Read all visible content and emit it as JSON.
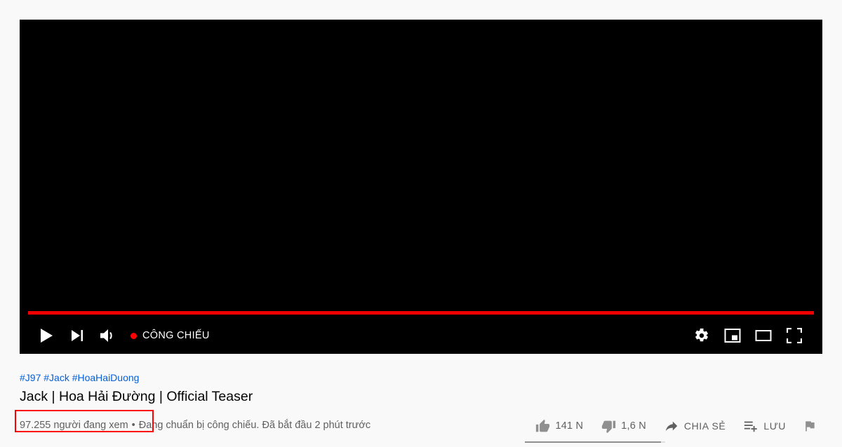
{
  "player": {
    "progress_percent": 100,
    "controls_left": [
      {
        "name": "play-button",
        "icon": "play-icon",
        "label": "Phát"
      },
      {
        "name": "next-button",
        "icon": "next-track-icon",
        "label": "Tiếp theo"
      },
      {
        "name": "volume-button",
        "icon": "volume-icon",
        "label": "Âm lượng"
      }
    ],
    "live_badge": {
      "label": "CÔNG CHIẾU",
      "dot_color": "#ff0000"
    },
    "controls_right": [
      {
        "name": "settings-button",
        "icon": "gear-icon",
        "label": "Cài đặt"
      },
      {
        "name": "miniplayer-button",
        "icon": "miniplayer-icon",
        "label": "Trình phát thu nhỏ"
      },
      {
        "name": "theater-button",
        "icon": "theater-mode-icon",
        "label": "Chế độ rạp hát"
      },
      {
        "name": "fullscreen-button",
        "icon": "fullscreen-icon",
        "label": "Toàn màn hình"
      }
    ]
  },
  "video": {
    "hashtags": [
      "#J97",
      "#Jack",
      "#HoaHaiDuong"
    ],
    "hashtags_text": "#J97 #Jack #HoaHaiDuong",
    "title": "Jack | Hoa Hải Đường | Official Teaser",
    "viewer_count_text": "97.255 người đang xem",
    "separator": "•",
    "status_text": "Đang chuẩn bị công chiếu. Đã bắt đầu 2 phút trước",
    "highlight_color": "#ff0000"
  },
  "actions": {
    "like": {
      "label": "141 N",
      "icon": "thumbs-up-icon"
    },
    "dislike": {
      "label": "1,6 N",
      "icon": "thumbs-down-icon"
    },
    "share": {
      "label": "CHIA SẺ",
      "icon": "share-icon"
    },
    "save": {
      "label": "LƯU",
      "icon": "save-to-playlist-icon"
    },
    "report": {
      "label": "",
      "icon": "flag-icon"
    },
    "rating_ratio_percent": 97
  },
  "colors": {
    "page_background": "#f9f9f9",
    "progress_red": "#f00000",
    "link_blue": "#065fd4",
    "text_primary": "#030303",
    "text_secondary": "#606060"
  }
}
